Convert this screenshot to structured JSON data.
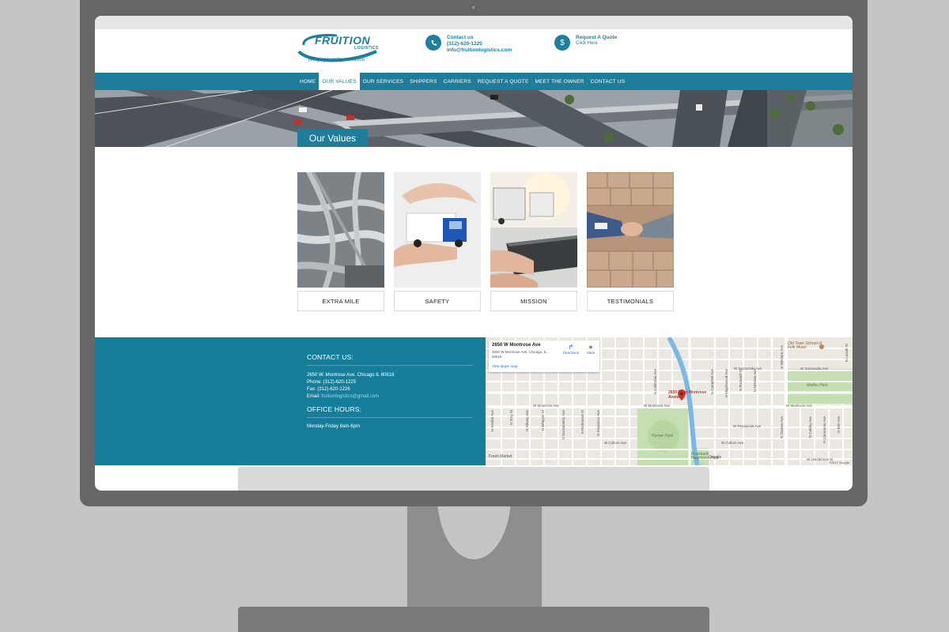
{
  "colors": {
    "brand_teal": "#1e7d9a",
    "monitor_frame": "#666666",
    "background": "#c5c5c5"
  },
  "header": {
    "logo": {
      "title": "FRUITION",
      "subtitle": "LOGISTICS",
      "tagline": "Bringing logistics to fruition"
    },
    "contact": {
      "icon": "phone-icon",
      "heading": "Contact us",
      "phone": "(312)-620-1225",
      "email": "info@fruitionlogistics.com"
    },
    "quote": {
      "icon": "dollar-icon",
      "heading": "Request A Quote",
      "link": "Click Here"
    }
  },
  "nav": {
    "items": [
      {
        "label": "HOME",
        "active": false
      },
      {
        "label": "OUR VALUES",
        "active": true
      },
      {
        "label": "OUR SERVICES",
        "active": false
      },
      {
        "label": "SHIPPERS",
        "active": false
      },
      {
        "label": "CARRIERS",
        "active": false
      },
      {
        "label": "REQUEST A QUOTE",
        "active": false
      },
      {
        "label": "MEET THE OWNER",
        "active": false
      },
      {
        "label": "CONTACT US",
        "active": false
      }
    ]
  },
  "banner": {
    "title": "Our Values"
  },
  "cards": [
    {
      "label": "EXTRA MILE",
      "image": "highway-interchange"
    },
    {
      "label": "SAFETY",
      "image": "hands-truck"
    },
    {
      "label": "MISSION",
      "image": "laptop-trucks"
    },
    {
      "label": "TESTIMONIALS",
      "image": "handshake-boxes"
    }
  ],
  "footer": {
    "contact_heading": "CONTACT US:",
    "address": "2650 W. Montrose Ave. Chicago IL 60618",
    "phone": "Phone: (312)-620-1225",
    "fax": "Fax: (312)-620-1226",
    "email_label": "Email: ",
    "email": "fruitionlogistics@gmail.com",
    "hours_heading": "OFFICE HOURS:",
    "hours": "Monday-Friday 8am-6pm"
  },
  "map": {
    "place_title": "2650 W Montrose Ave",
    "place_address": "2650 W Montrose Ave, Chicago, IL 60618",
    "view_larger": "View larger map",
    "directions": "Directions",
    "save": "Save",
    "pin_label": "2650 West Montrose Avenue",
    "labels": {
      "montrose1": "W Montrose Ave",
      "montrose2": "W Montrose Ave",
      "montrose3": "W Montrose Ave",
      "sunnyside1": "W Sunnyside Ave",
      "sunnyside2": "W Sunnyside Ave",
      "pensacola": "W Pensacola Ave",
      "cullom1": "W Cullom Ave",
      "cullom2": "W Cullom Ave",
      "hutchinson": "W Hutchinson St",
      "california": "N California Ave",
      "richmond": "N Richmond St",
      "francisco": "N Francisco Ave",
      "western": "N Western Ave",
      "campbell": "N Campbell Ave",
      "maplewood": "N Maplewood Ave",
      "rockwell": "N Rockwell St",
      "kedzie": "N Kedzie Ave",
      "troy": "N Troy St",
      "albany": "N Albany Ave",
      "whipple": "N Whipple St",
      "sacramento": "N Sacramento Ave",
      "artesian": "N Artesian Ave",
      "damen": "N Damen Ave",
      "oakley": "N Oakley Ave",
      "bell": "N Bell Ave",
      "claremont": "N Claremont Ave",
      "leavitt": "N Leavitt St"
    },
    "parks": {
      "horner": "Horner Park",
      "welles": "Welles Park",
      "riverbank": "Riverbank Neighbors Park"
    },
    "poi": "Old Town School of Folk Music",
    "market": "Fresh Market",
    "google": "Google",
    "copyright": "©2017 Google"
  }
}
